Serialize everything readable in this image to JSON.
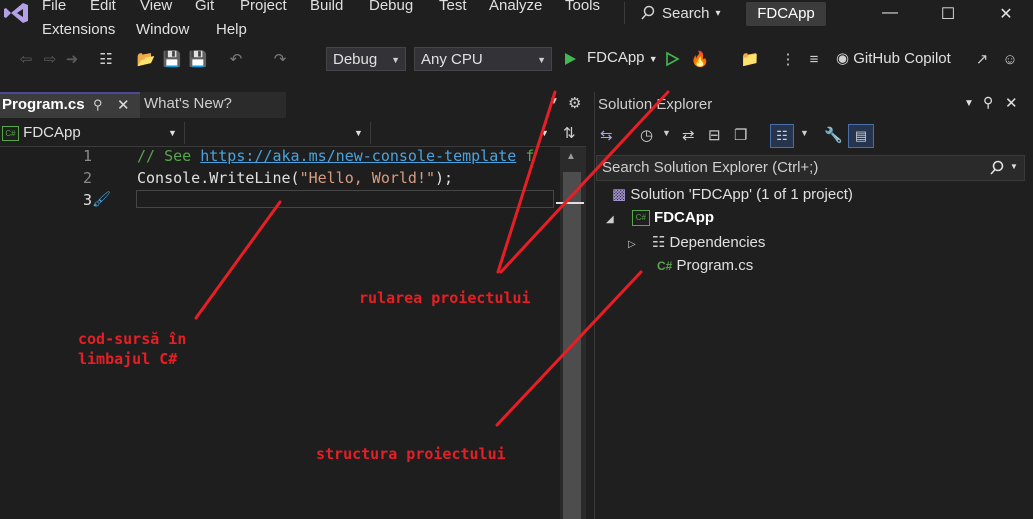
{
  "menu": {
    "row1": [
      "File",
      "Edit",
      "View",
      "Git",
      "Project",
      "Build",
      "Debug",
      "Test",
      "Analyze",
      "Tools"
    ],
    "row2": [
      "Extensions",
      "Window",
      "Help"
    ]
  },
  "search": {
    "label": "Search"
  },
  "app_title": "FDCApp",
  "toolbar": {
    "config": "Debug",
    "platform": "Any CPU",
    "run_target": "FDCApp",
    "copilot": "GitHub Copilot"
  },
  "editor": {
    "tabs": [
      {
        "label": "Program.cs",
        "active": true
      },
      {
        "label": "What's New?",
        "active": false
      }
    ],
    "nav_project": "FDCApp",
    "lines": [
      {
        "num": "1",
        "comment": "// See ",
        "link": "https://aka.ms/new-console-template",
        "tail": " f"
      },
      {
        "num": "2",
        "obj": "Console",
        "dot": ".",
        "method": "WriteLine",
        "open": "(",
        "str": "\"Hello, World!\"",
        "close": ");"
      },
      {
        "num": "3"
      }
    ]
  },
  "solution_explorer": {
    "title": "Solution Explorer",
    "search_placeholder": "Search Solution Explorer (Ctrl+;)",
    "solution": "Solution 'FDCApp' (1 of 1 project)",
    "project": "FDCApp",
    "dependencies": "Dependencies",
    "file": "Program.cs"
  },
  "annotations": {
    "source": [
      "cod-sursă în",
      "limbajul C#"
    ],
    "run": "rularea proiectului",
    "structure": "structura proiectului"
  },
  "colors": {
    "annotation": "#e81e25",
    "comment": "#57a64a",
    "link": "#4aa3df",
    "string": "#d69d85",
    "run_green": "#3fb950"
  }
}
